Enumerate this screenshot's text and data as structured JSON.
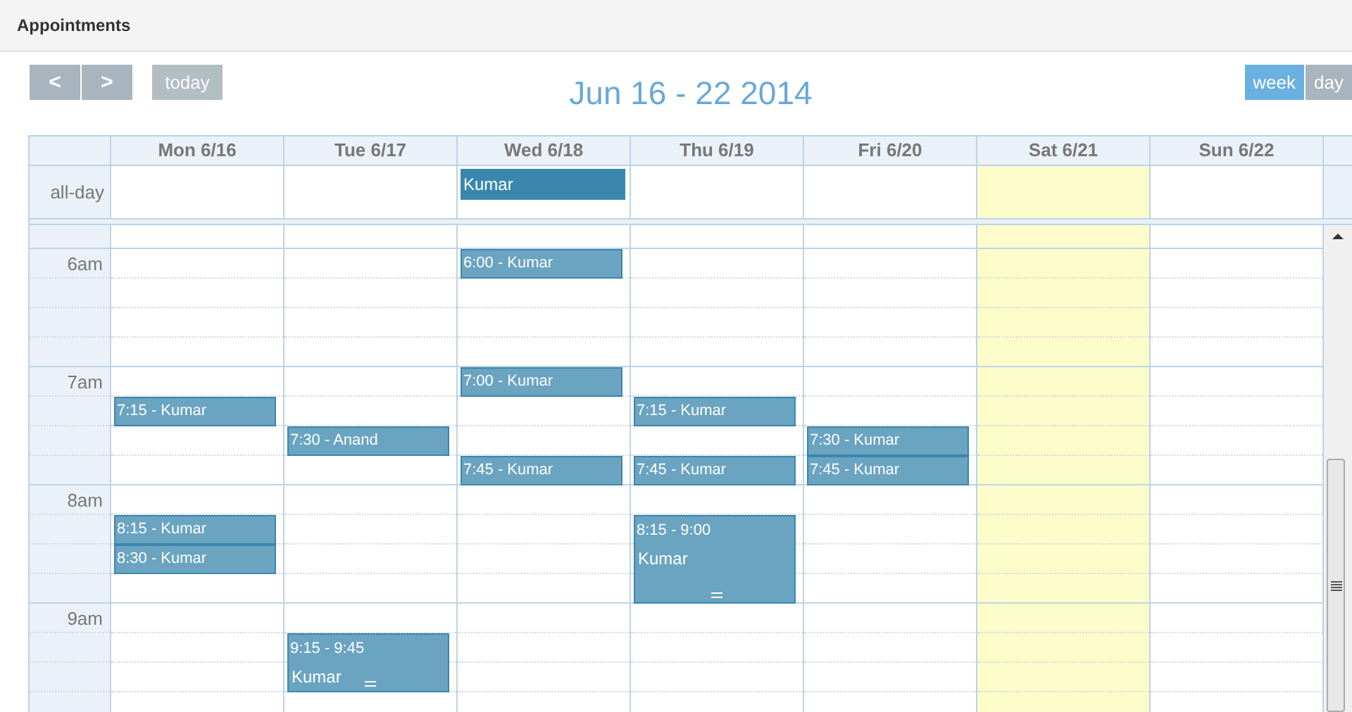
{
  "panel": {
    "title": "Appointments"
  },
  "toolbar": {
    "prev": "<",
    "next": ">",
    "today": {
      "label": "today",
      "disabled": true
    },
    "title": "Jun 16 - 22 2014",
    "views": [
      {
        "label": "week",
        "selected": true
      },
      {
        "label": "day",
        "selected": false
      }
    ]
  },
  "all_day_label": "all-day",
  "hours": [
    {
      "label": "6am"
    },
    {
      "label": "7am"
    },
    {
      "label": "8am"
    },
    {
      "label": "9am"
    }
  ],
  "days": [
    {
      "header": "Mon 6/16",
      "today": false,
      "events": [
        {
          "kind": "short",
          "label": "7:15 - Kumar"
        },
        {
          "kind": "short",
          "label": "8:15 - Kumar"
        },
        {
          "kind": "short",
          "label": "8:30 - Kumar"
        }
      ]
    },
    {
      "header": "Tue 6/17",
      "today": false,
      "events": [
        {
          "kind": "short",
          "label": "7:30 - Anand"
        },
        {
          "kind": "long",
          "time": "9:15 - 9:45",
          "title": "Kumar"
        }
      ]
    },
    {
      "header": "Wed 6/18",
      "today": false,
      "all_day": [
        {
          "title": "Kumar"
        }
      ],
      "events": [
        {
          "kind": "short",
          "label": "6:00 - Kumar"
        },
        {
          "kind": "short",
          "label": "7:00 - Kumar"
        },
        {
          "kind": "short",
          "label": "7:45 - Kumar"
        }
      ]
    },
    {
      "header": "Thu 6/19",
      "today": false,
      "events": [
        {
          "kind": "short",
          "label": "7:15 - Kumar"
        },
        {
          "kind": "short",
          "label": "7:45 - Kumar"
        },
        {
          "kind": "long",
          "time": "8:15 - 9:00",
          "title": "Kumar"
        }
      ]
    },
    {
      "header": "Fri 6/20",
      "today": false,
      "events": [
        {
          "kind": "short",
          "label": "7:30 - Kumar"
        },
        {
          "kind": "short",
          "label": "7:45 - Kumar"
        }
      ]
    },
    {
      "header": "Sat 6/21",
      "today": true
    },
    {
      "header": "Sun 6/22",
      "today": false
    }
  ]
}
